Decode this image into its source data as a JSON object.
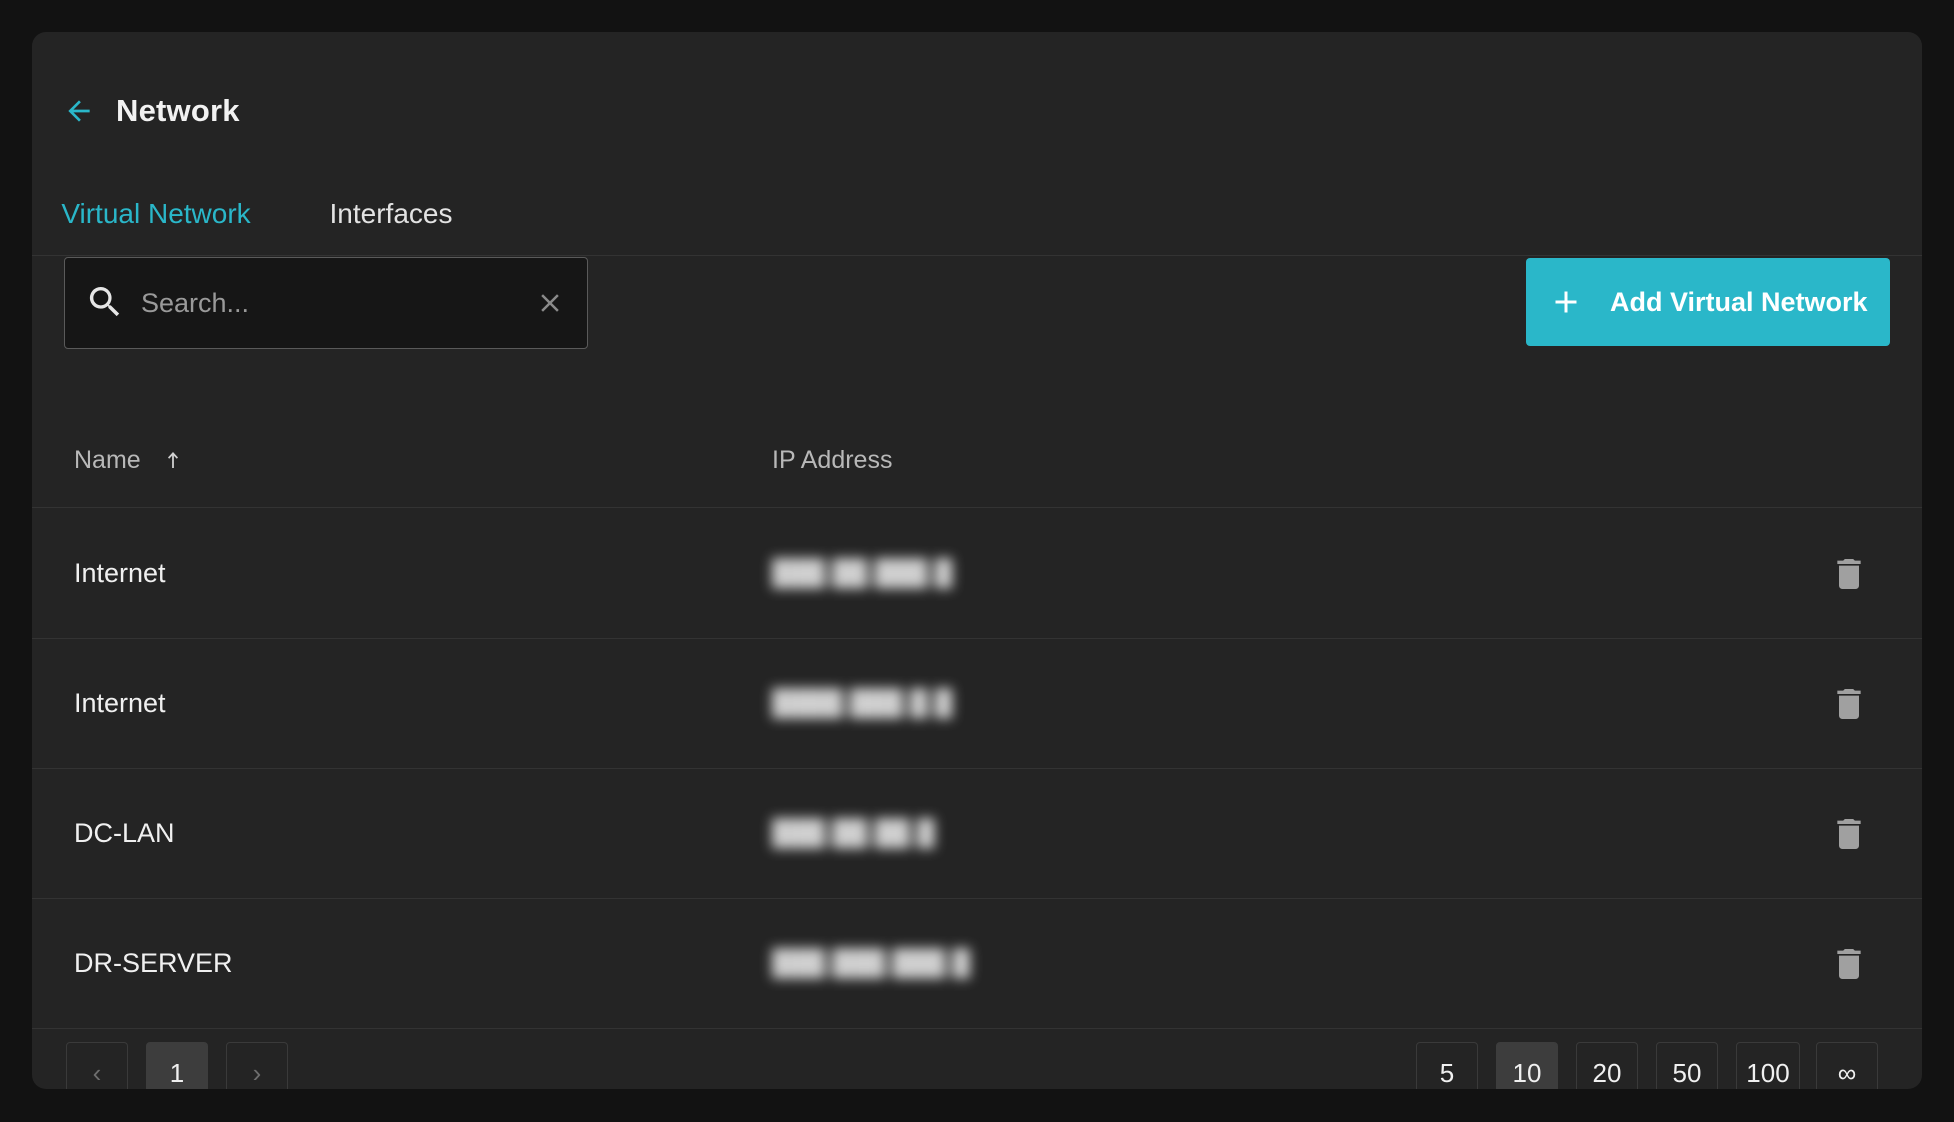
{
  "header": {
    "title": "Network",
    "back_icon": "arrow-left-icon"
  },
  "tabs": [
    {
      "label": "Virtual Network",
      "active": true
    },
    {
      "label": "Interfaces",
      "active": false
    }
  ],
  "toolbar": {
    "search_placeholder": "Search...",
    "search_value": "",
    "add_button_label": "Add Virtual Network"
  },
  "table": {
    "columns": {
      "name": "Name",
      "ip": "IP Address",
      "sort": "ascending"
    },
    "rows": [
      {
        "name": "Internet",
        "ip": "███.██.███.█"
      },
      {
        "name": "Internet",
        "ip": "████.███.█.█"
      },
      {
        "name": "DC-LAN",
        "ip": "███.██.██.█"
      },
      {
        "name": "DR-SERVER",
        "ip": "███.███.███.█"
      }
    ]
  },
  "pagination": {
    "prev_label": "‹",
    "next_label": "›",
    "current_page": "1",
    "page_sizes": [
      "5",
      "10",
      "20",
      "50",
      "100",
      "∞"
    ],
    "selected_page_size": "10"
  },
  "colors": {
    "accent": "#2ab7c9",
    "background": "#121212",
    "panel": "#242424"
  }
}
